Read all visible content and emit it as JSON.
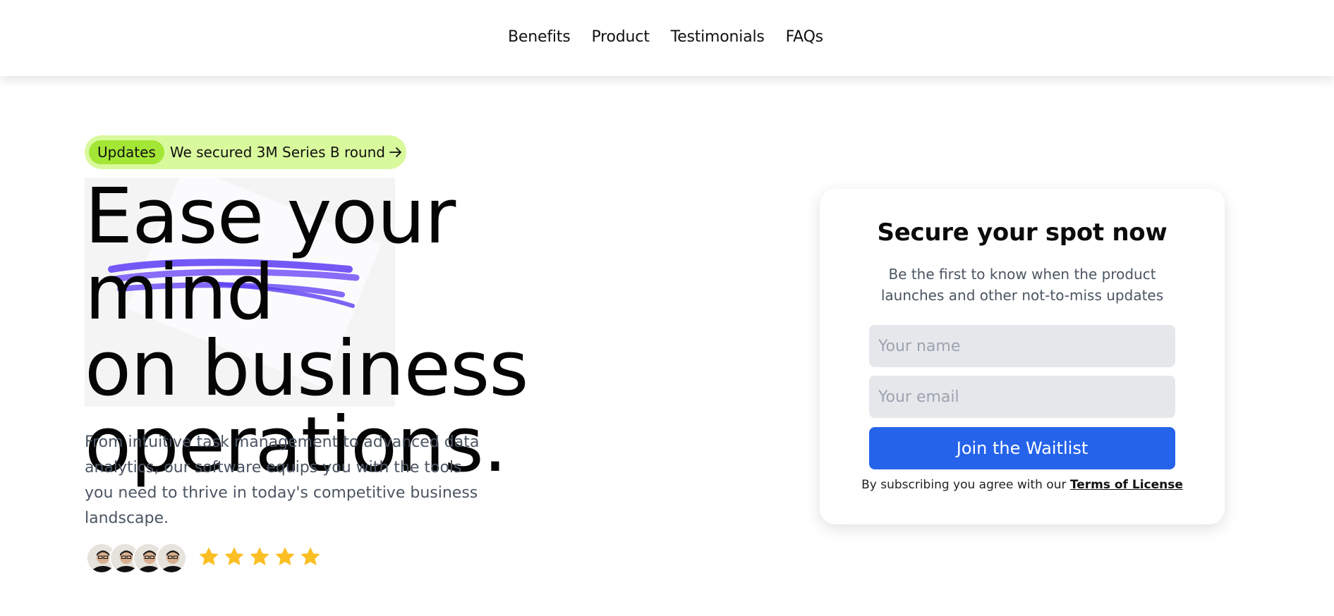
{
  "nav": {
    "items": [
      {
        "label": "Benefits"
      },
      {
        "label": "Product"
      },
      {
        "label": "Testimonials"
      },
      {
        "label": "FAQs"
      }
    ]
  },
  "badge": {
    "tag": "Updates",
    "text": "We secured 3M Series B round"
  },
  "hero": {
    "headline_line1": "Ease your mind",
    "headline_line2": "on business",
    "headline_line3": "operations.",
    "subtext": "From intuitive task management to advanced data analytics, our software equips you with the tools you need to thrive in today's competitive business landscape.",
    "rating": 5
  },
  "signup": {
    "title": "Secure your spot now",
    "description": "Be the first to know when the product launches and other not-to-miss updates",
    "name_placeholder": "Your name",
    "email_placeholder": "Your email",
    "button_label": "Join the Waitlist",
    "terms_prefix": "By subscribing you agree with our",
    "terms_link": "Terms of License"
  },
  "colors": {
    "badge_bg": "#d9f99d",
    "badge_tag_bg": "#a3e635",
    "button_bg": "#2563eb",
    "star": "#fbbf24",
    "scribble": "#6d4ff5"
  }
}
